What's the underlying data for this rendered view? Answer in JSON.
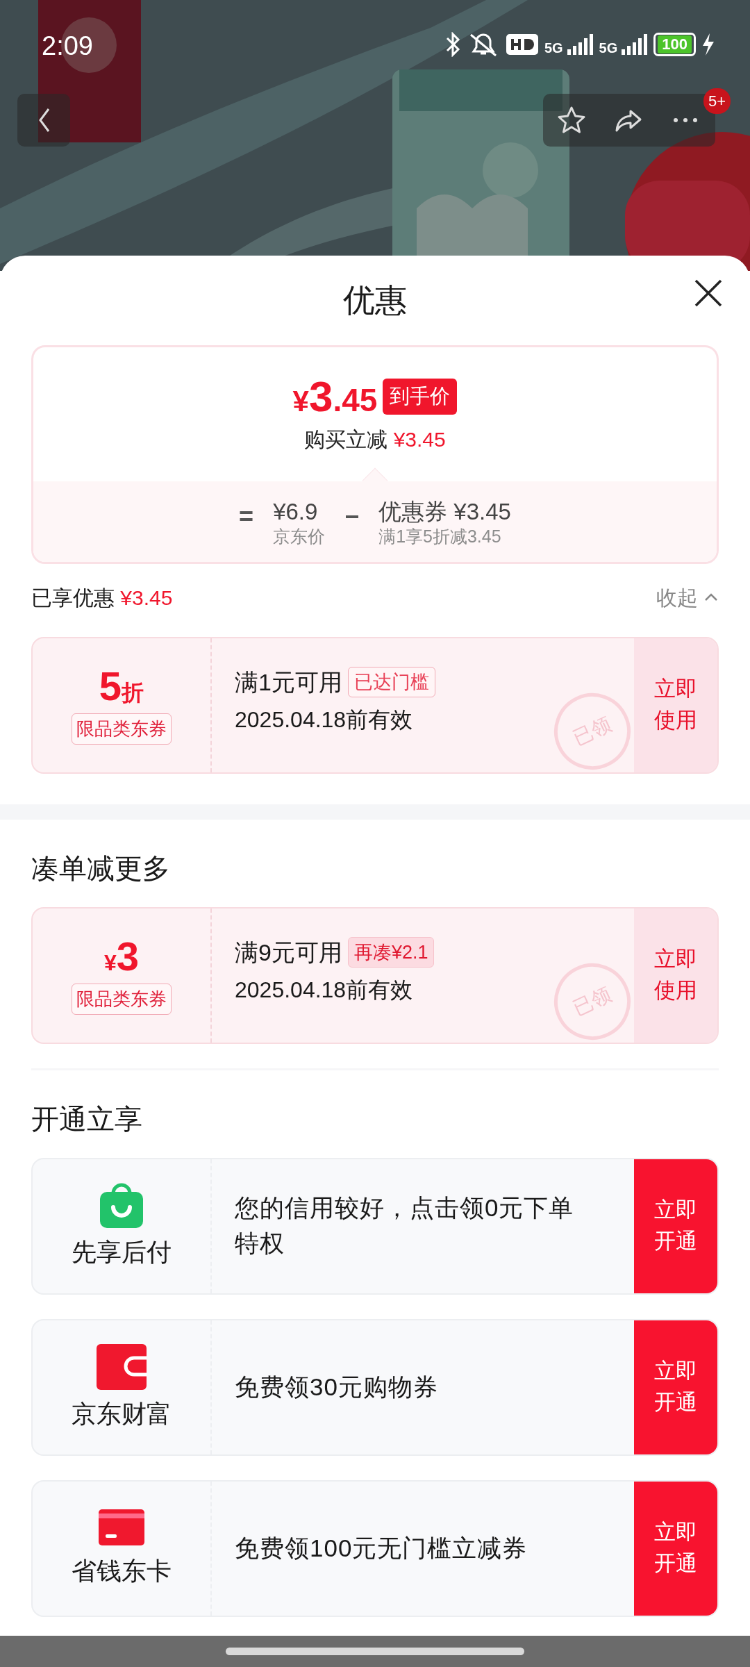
{
  "status_bar": {
    "time": "2:09",
    "network_labels": [
      "5G",
      "5G"
    ],
    "battery": "100"
  },
  "header": {
    "more_badge": "5+"
  },
  "sheet": {
    "title": "优惠"
  },
  "price_summary": {
    "currency": "¥",
    "integer": "3",
    "decimal": ".45",
    "tag": "到手价",
    "savings_label": "购买立减",
    "savings_amount": "¥3.45",
    "breakdown": [
      {
        "kind": "operator",
        "text": "="
      },
      {
        "kind": "amount",
        "value": "¥6.9",
        "note": "京东价"
      },
      {
        "kind": "operator",
        "text": "−"
      },
      {
        "kind": "amount",
        "value": "优惠券 ¥3.45",
        "note": "满1享5折减3.45"
      }
    ]
  },
  "enjoyed": {
    "label": "已享优惠",
    "amount": "¥3.45",
    "toggle": "收起",
    "expanded": true
  },
  "applied_coupons": [
    {
      "kind": "discount",
      "value": "5",
      "unit": "折",
      "type_tag": "限品类东券",
      "condition": "满1元可用",
      "status_tag": "已达门槛",
      "threshold_met": true,
      "validity": "2025.04.18前有效",
      "stamp": "已领",
      "action": "立即使用"
    }
  ],
  "more_section": {
    "title": "凑单减更多",
    "coupons": [
      {
        "kind": "amount",
        "value": "3",
        "unit": "¥",
        "type_tag": "限品类东券",
        "condition": "满9元可用",
        "status_tag": "再凑¥2.1",
        "threshold_met": false,
        "validity": "2025.04.18前有效",
        "stamp": "已领",
        "action": "立即使用"
      }
    ]
  },
  "services_section": {
    "title": "开通立享",
    "services": [
      {
        "kind": "bag",
        "name": "先享后付",
        "description": "您的信用较好，点击领0元下单特权",
        "action": "立即开通"
      },
      {
        "kind": "wallet",
        "name": "京东财富",
        "description": "免费领30元购物券",
        "action": "立即开通"
      },
      {
        "kind": "card",
        "name": "省钱东卡",
        "description": "免费领100元无门槛立减券",
        "action": "立即开通"
      }
    ]
  }
}
